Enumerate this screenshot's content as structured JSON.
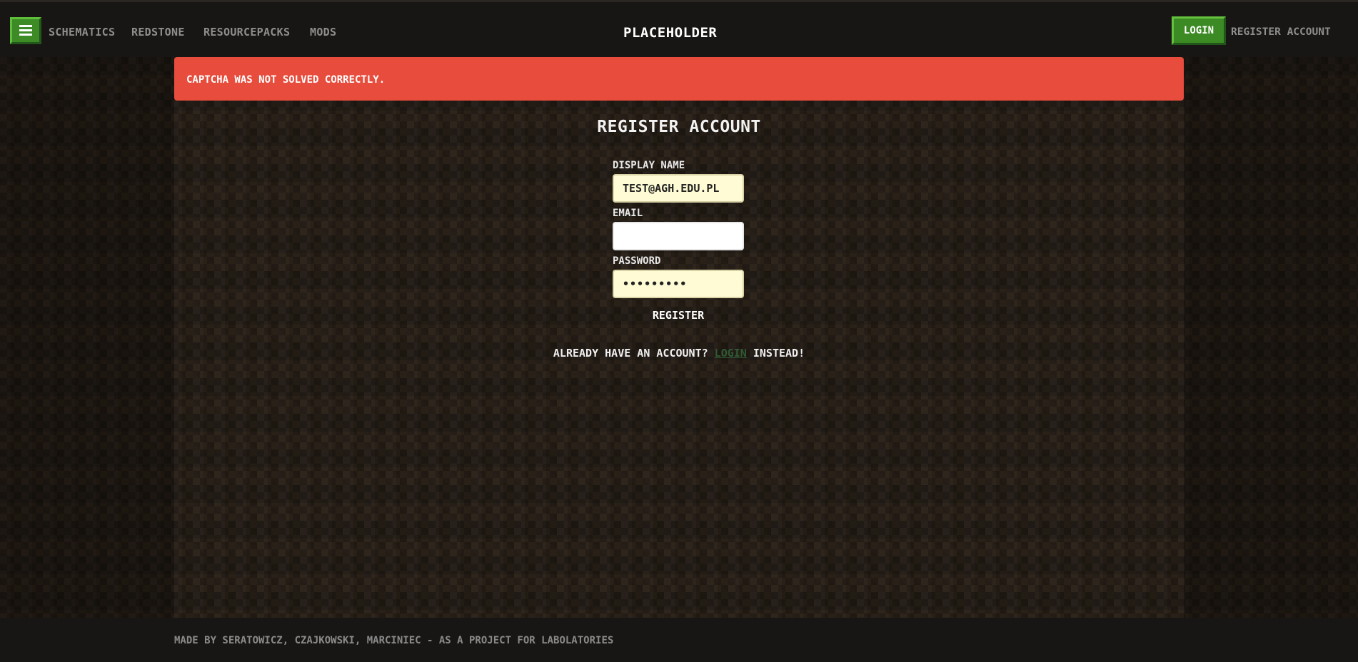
{
  "header": {
    "menu_icon": "hamburger-icon",
    "nav": [
      "SCHEMATICS",
      "REDSTONE",
      "RESOURCEPACKS",
      "MODS"
    ],
    "site_title": "PLACEHOLDER",
    "login_label": "LOGIN",
    "register_label": "REGISTER ACCOUNT"
  },
  "alert": {
    "message": "CAPTCHA WAS NOT SOLVED CORRECTLY.",
    "color": "#e74c3c"
  },
  "form": {
    "title": "REGISTER ACCOUNT",
    "display_name_label": "DISPLAY NAME",
    "display_name_value": "TEST@AGH.EDU.PL",
    "email_label": "EMAIL",
    "email_value": "",
    "password_label": "PASSWORD",
    "password_value": "•••••••••",
    "submit_label": "REGISTER",
    "alt_prefix": "ALREADY HAVE AN ACCOUNT?",
    "alt_link": "LOGIN",
    "alt_suffix": "INSTEAD!"
  },
  "footer": {
    "text": "MADE BY SERATOWICZ, CZAJKOWSKI, MARCINIEC - AS A PROJECT FOR LABOLATORIES"
  },
  "colors": {
    "accent_green": "#3d8b25",
    "input_fill": "#fffbd4"
  }
}
